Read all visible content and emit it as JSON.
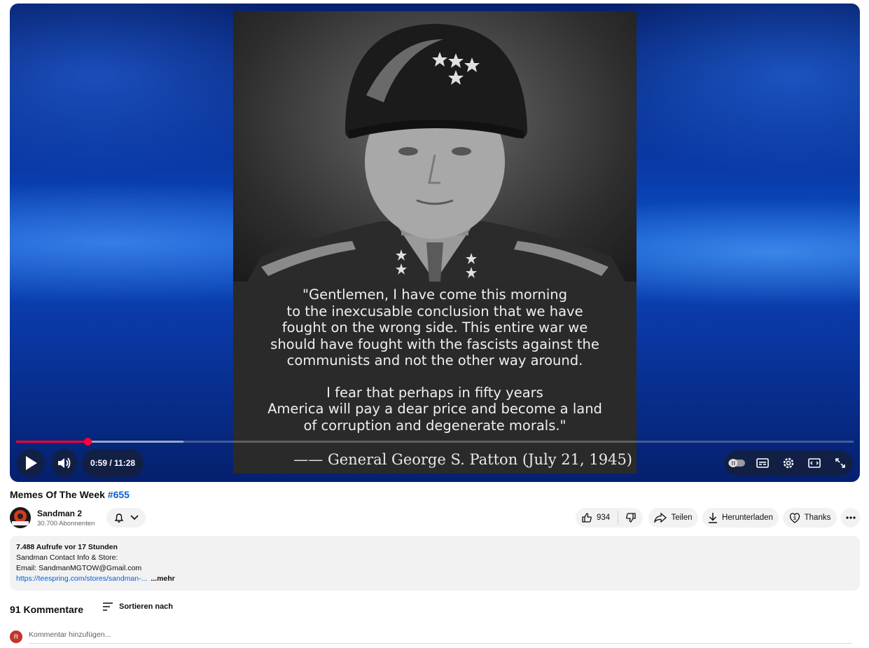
{
  "video": {
    "quote_paragraph_1": "\"Gentlemen, I have come this morning\nto the inexcusable conclusion that we have\nfought on the wrong side. This entire war we\nshould have fought with the fascists against the\ncommunists and not the other way around.",
    "quote_paragraph_2": "I fear that perhaps in fifty years\nAmerica will pay a dear price and become a land\nof corruption and degenerate morals.\"",
    "attribution": "—— General George S. Patton (July 21, 1945)",
    "time_display": "0:59 / 11:28",
    "progress_played_fraction": 0.0857,
    "progress_buffered_fraction": 0.2,
    "icons": [
      "play-icon",
      "volume-icon",
      "autoplay-toggle-icon",
      "subtitles-icon",
      "settings-icon",
      "theater-mode-icon",
      "fullscreen-icon"
    ]
  },
  "title": {
    "text": "Memes Of The Week ",
    "hashtag": "#655"
  },
  "channel": {
    "name": "Sandman 2",
    "subscribers": "30.700 Abonnenten"
  },
  "actions": {
    "like_count": "934",
    "share_label": "Teilen",
    "download_label": "Herunterladen",
    "thanks_label": "Thanks"
  },
  "description": {
    "meta": "7.488 Aufrufe  vor 17 Stunden",
    "line1": "Sandman Contact Info & Store:",
    "line2": "Email: SandmanMGTOW@Gmail.com",
    "link": "https://teespring.com/stores/sandman-...",
    "more": "...mehr"
  },
  "comments": {
    "count_label": "91 Kommentare",
    "sort_label": "Sortieren nach",
    "user_initial": "R",
    "placeholder": "Kommentar hinzufügen..."
  },
  "colors": {
    "accent_red": "#ff0033",
    "link_blue": "#065fd4",
    "pill_bg": "#f2f2f2"
  }
}
